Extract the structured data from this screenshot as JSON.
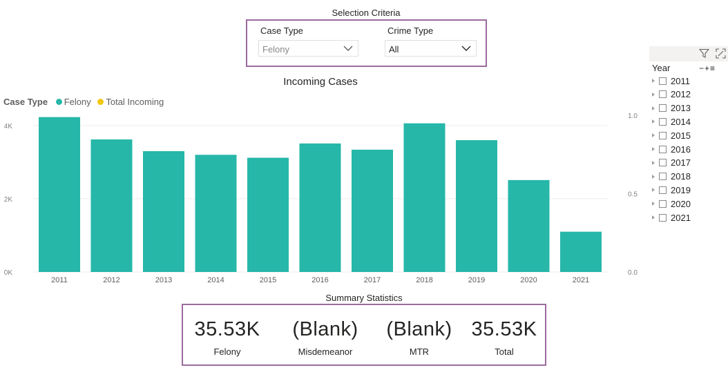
{
  "selection": {
    "title": "Selection Criteria",
    "case_type": {
      "label": "Case Type",
      "value": "Felony"
    },
    "crime_type": {
      "label": "Crime Type",
      "value": "All"
    }
  },
  "chart_data": {
    "type": "bar",
    "title": "Incoming Cases",
    "legend_title": "Case Type",
    "legend": [
      {
        "name": "Felony",
        "color": "#26b7a9"
      },
      {
        "name": "Total Incoming",
        "color": "#f2c811"
      }
    ],
    "categories": [
      "2011",
      "2012",
      "2013",
      "2014",
      "2015",
      "2016",
      "2017",
      "2018",
      "2019",
      "2020",
      "2021"
    ],
    "series": [
      {
        "name": "Felony",
        "values": [
          4230,
          3620,
          3300,
          3200,
          3120,
          3510,
          3340,
          4060,
          3600,
          2510,
          1100
        ]
      }
    ],
    "y_ticks": [
      "0K",
      "2K",
      "4K"
    ],
    "ylim": [
      0,
      4600
    ],
    "y2_ticks": [
      "0.0",
      "0.5",
      "1.0"
    ],
    "y2lim": [
      0,
      1.0
    ],
    "grid": true,
    "bar_color": "#26b7a9"
  },
  "year_slicer": {
    "title": "Year",
    "controls": "−+≡",
    "years": [
      "2011",
      "2012",
      "2013",
      "2014",
      "2015",
      "2016",
      "2017",
      "2018",
      "2019",
      "2020",
      "2021"
    ]
  },
  "summary": {
    "title": "Summary Statistics",
    "cards": [
      {
        "value": "35.53K",
        "label": "Felony"
      },
      {
        "value": "(Blank)",
        "label": "Misdemeanor"
      },
      {
        "value": "(Blank)",
        "label": "MTR"
      },
      {
        "value": "35.53K",
        "label": "Total"
      }
    ]
  }
}
